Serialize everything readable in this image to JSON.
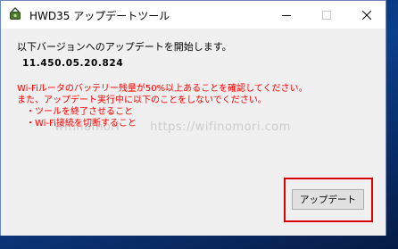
{
  "window": {
    "title": "HWD35 アップデートツール",
    "app_icon": "router-icon",
    "controls": {
      "minimize": "minimize-icon",
      "maximize": "maximize-icon",
      "close": "close-icon"
    }
  },
  "content": {
    "intro": "以下バージョンへのアップデートを開始します。",
    "version": "11.450.05.20.824",
    "warnings": [
      "Wi-Fiルータのバッテリー残量が50%以上あることを確認してください。",
      "また、アップデート実行中に以下のことをしないでください。",
      "・ツールを終了させること",
      "・Wi-Fi接続を切断すること"
    ],
    "warning_color": "#ff0000"
  },
  "watermark": {
    "site_name": "wifinomori",
    "url": "https://wifinomori.com"
  },
  "button": {
    "update_label": "アップデート"
  },
  "annotation": {
    "highlight_color": "#e00000"
  }
}
